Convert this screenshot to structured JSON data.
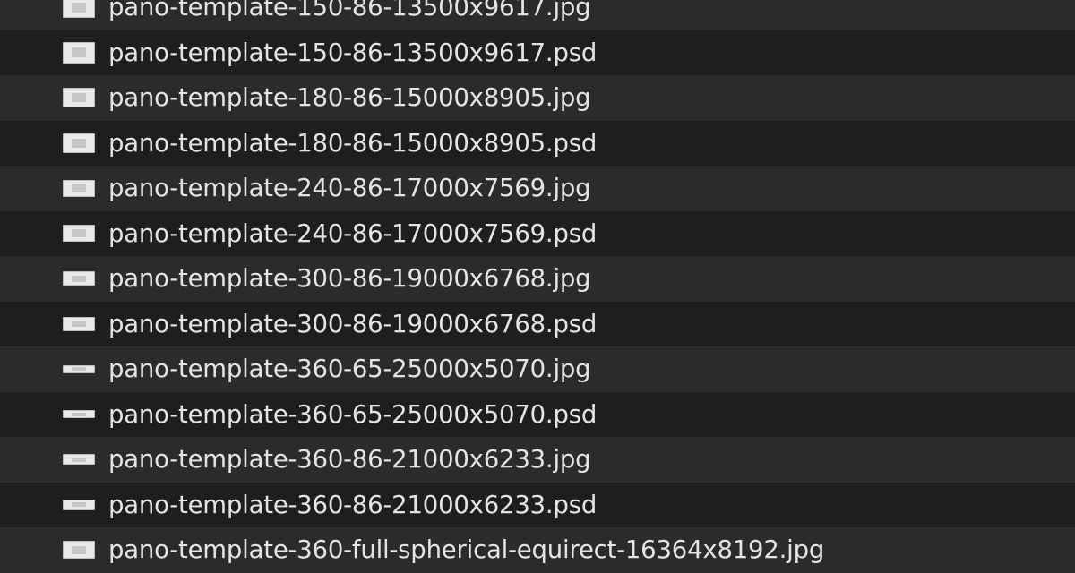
{
  "files": [
    {
      "name": "pano-template-150-86-13500x9617.jpg",
      "icon": "panorama-image-icon"
    },
    {
      "name": "pano-template-150-86-13500x9617.psd",
      "icon": "panorama-image-icon"
    },
    {
      "name": "pano-template-180-86-15000x8905.jpg",
      "icon": "panorama-image-icon"
    },
    {
      "name": "pano-template-180-86-15000x8905.psd",
      "icon": "panorama-image-icon"
    },
    {
      "name": "pano-template-240-86-17000x7569.jpg",
      "icon": "panorama-image-icon"
    },
    {
      "name": "pano-template-240-86-17000x7569.psd",
      "icon": "panorama-image-icon"
    },
    {
      "name": "pano-template-300-86-19000x6768.jpg",
      "icon": "panorama-image-icon"
    },
    {
      "name": "pano-template-300-86-19000x6768.psd",
      "icon": "panorama-image-icon"
    },
    {
      "name": "pano-template-360-65-25000x5070.jpg",
      "icon": "panorama-image-icon"
    },
    {
      "name": "pano-template-360-65-25000x5070.psd",
      "icon": "panorama-image-icon"
    },
    {
      "name": "pano-template-360-86-21000x6233.jpg",
      "icon": "panorama-image-icon"
    },
    {
      "name": "pano-template-360-86-21000x6233.psd",
      "icon": "panorama-image-icon"
    },
    {
      "name": "pano-template-360-full-spherical-equirect-16364x8192.jpg",
      "icon": "panorama-image-icon"
    }
  ],
  "colors": {
    "row_even": "#2b2b2e",
    "row_odd": "#1e1e21",
    "text": "#e4e4e6"
  }
}
